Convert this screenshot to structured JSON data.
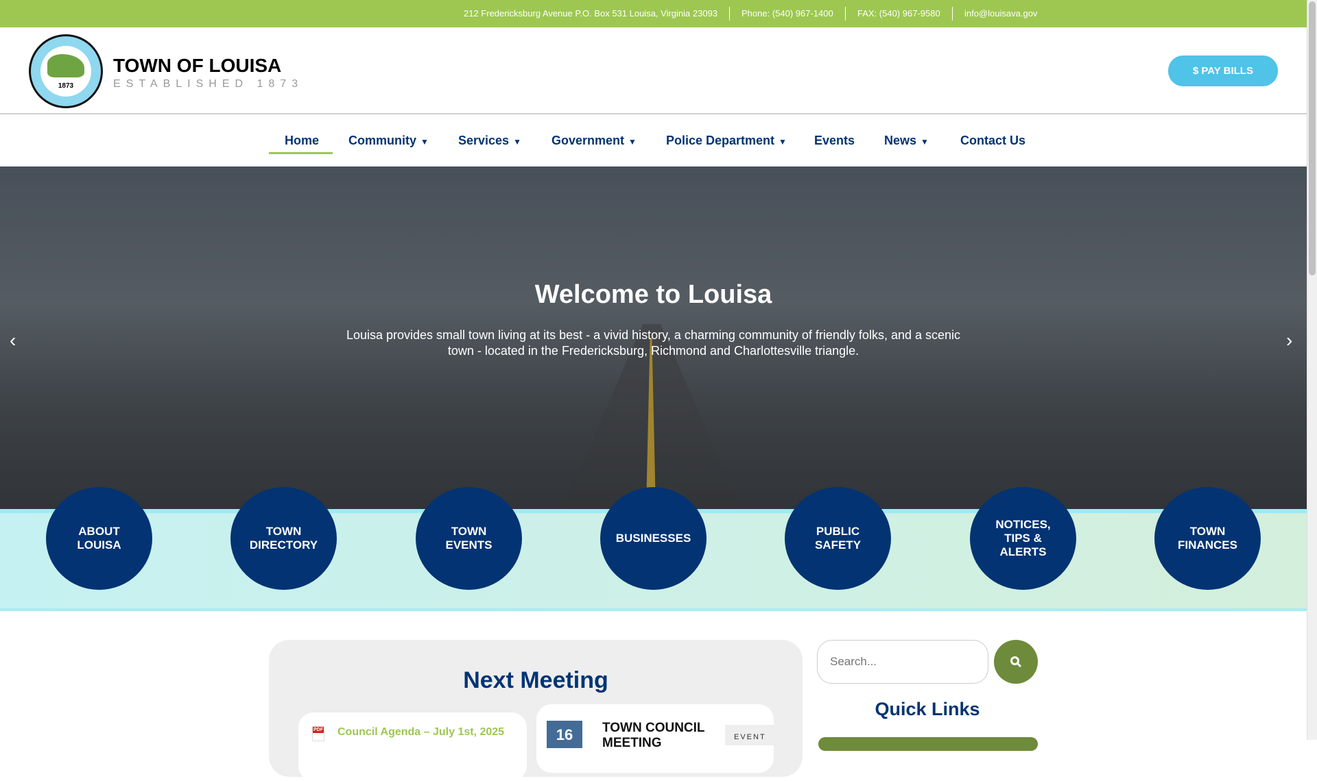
{
  "topbar": {
    "address": "212 Fredericksburg Avenue P.O. Box 531 Louisa, Virginia 23093",
    "phone": "Phone: (540) 967-1400",
    "fax": "FAX: (540) 967-9580",
    "email": "info@louisava.gov"
  },
  "header": {
    "title": "TOWN OF LOUISA",
    "tagline": "ESTABLISHED 1873",
    "logo_year": "1873",
    "pay_bills": "PAY BILLS"
  },
  "nav": [
    {
      "label": "Home",
      "active": true
    },
    {
      "label": "Community",
      "caret": "▼"
    },
    {
      "label": "Services",
      "caret": "▼"
    },
    {
      "label": "Government",
      "caret": "▼"
    },
    {
      "label": "Police Department",
      "caret": "▼"
    },
    {
      "label": "Events"
    },
    {
      "label": "News",
      "caret": "▼"
    },
    {
      "label": "Contact Us"
    }
  ],
  "hero": {
    "title": "Welcome to Louisa",
    "text": "Louisa provides small town living at its best - a vivid history, a charming community of friendly folks, and a scenic town - located in the Fredericksburg, Richmond and Charlottesville triangle.",
    "prev": "‹",
    "next": "›"
  },
  "quick_circles": [
    "ABOUT LOUISA",
    "TOWN DIRECTORY",
    "TOWN EVENTS",
    "BUSINESSES",
    "PUBLIC SAFETY",
    "NOTICES, TIPS & ALERTS",
    "TOWN FINANCES"
  ],
  "meeting": {
    "title": "Next Meeting",
    "agenda_link": "Council Agenda – July 1st, 2025",
    "pdf_label": "PDF",
    "event_day": "16",
    "event_title": "TOWN COUNCIL MEETING",
    "event_type": "EVENT"
  },
  "sidebar": {
    "search_placeholder": "Search...",
    "quick_links_title": "Quick Links"
  },
  "colors": {
    "green": "#9dc751",
    "navy": "#003473",
    "cyan": "#4fc3e8",
    "olive": "#6d8b3a"
  }
}
